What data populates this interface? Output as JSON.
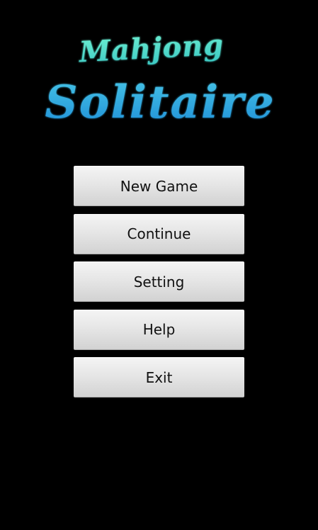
{
  "logo": {
    "line1": "Mahjong",
    "line2": "Solitaire",
    "color_top": "#5fe8c8",
    "color_bottom": "#2aa3e0"
  },
  "menu": {
    "items": [
      {
        "label": "New Game"
      },
      {
        "label": "Continue"
      },
      {
        "label": "Setting"
      },
      {
        "label": "Help"
      },
      {
        "label": "Exit"
      }
    ]
  },
  "colors": {
    "background": "#000000",
    "button_text": "#111111"
  }
}
